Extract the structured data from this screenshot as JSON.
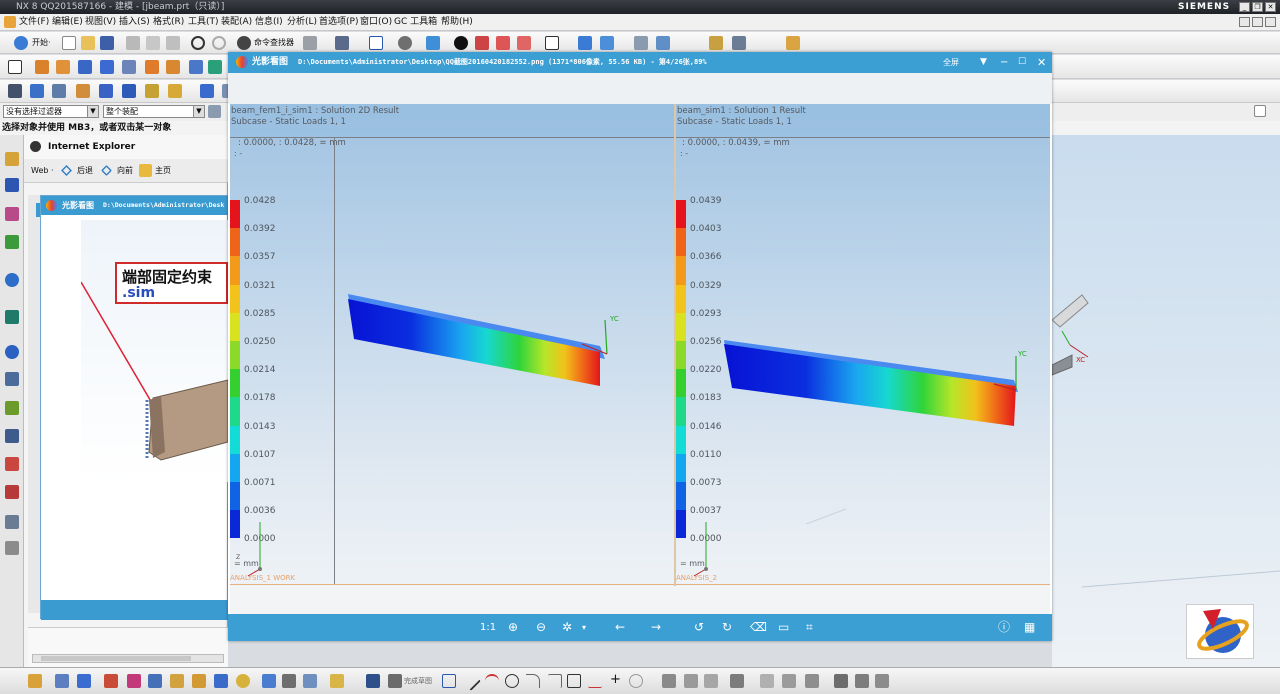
{
  "app": {
    "title": "NX 8 QQ201587166 - 建模 - [jbeam.prt（只读）]",
    "brand": "SIEMENS",
    "win_buttons": [
      "_",
      "❐",
      "✕"
    ],
    "menus": [
      "文件(F)",
      "编辑(E)",
      "视图(V)",
      "插入(S)",
      "格式(R)",
      "工具(T)",
      "装配(A)",
      "信息(I)",
      "分析(L)",
      "首选项(P)",
      "窗口(O)",
      "GC 工具箱",
      "帮助(H)"
    ],
    "toolbar_start": "开始·",
    "toolbar_cmd_finder": "命令查找器",
    "selection_filter": "没有选择过滤器",
    "assembly_scope": "整个装配",
    "status_hint": "选择对象并使用 MB3，或者双击某一对象",
    "sketch_label": "完成草图"
  },
  "ie": {
    "title": "Internet Explorer",
    "nav_web": "Web ·",
    "nav_back": "后退",
    "nav_forward": "向前",
    "nav_home": "主页",
    "inner_title": "光影看图",
    "inner_path": "D:\\Documents\\Administrator\\Desk",
    "callout_line1": "端部固定约束",
    "callout_line2": ".sim"
  },
  "viewer": {
    "app_name": "光影看图",
    "file_info": "D:\\Documents\\Administrator\\Desktop\\QQ截图20160420182552.png  (1371*806像素, 55.56 KB) - 第4/26张,89%",
    "fullscreen": "全屏",
    "toolbar_zoom": "1:1",
    "colors": {
      "title_bg": "#3c9fd3"
    },
    "left": {
      "line1": "beam_fem1_i_sim1 : Solution 2D Result",
      "line2": "Subcase - Static Loads 1,  1",
      "line3": ": 0.0000,   : 0.0428,  = mm",
      "line4": ": -",
      "unit": "= mm",
      "analysis": "ANALYSIS_1 WORK",
      "legend": [
        "0.0428",
        "0.0392",
        "0.0357",
        "0.0321",
        "0.0285",
        "0.0250",
        "0.0214",
        "0.0178",
        "0.0143",
        "0.0107",
        "0.0071",
        "0.0036",
        "0.0000"
      ]
    },
    "right": {
      "line1": "beam_sim1 : Solution 1 Result",
      "line2": "Subcase - Static Loads 1,  1",
      "line3": ": 0.0000,   : 0.0439,  = mm",
      "line4": ": -",
      "unit": "= mm",
      "analysis": "ANALYSIS_2",
      "legend": [
        "0.0439",
        "0.0403",
        "0.0366",
        "0.0329",
        "0.0293",
        "0.0256",
        "0.0220",
        "0.0183",
        "0.0146",
        "0.0110",
        "0.0073",
        "0.0037",
        "0.0000"
      ]
    },
    "axis_label": "YC",
    "axis_xc": "XC",
    "axis_z": "Z"
  }
}
